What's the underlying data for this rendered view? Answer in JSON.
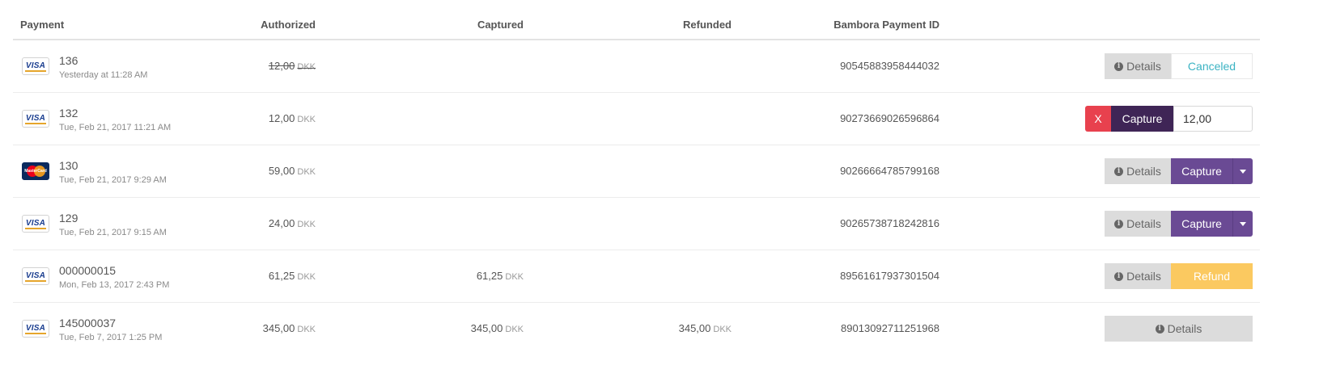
{
  "header": {
    "payment": "Payment",
    "authorized": "Authorized",
    "captured": "Captured",
    "refunded": "Refunded",
    "payment_id": "Bambora Payment ID"
  },
  "currency": "DKK",
  "actions": {
    "details": "Details",
    "canceled": "Canceled",
    "capture": "Capture",
    "cancel_x": "X",
    "refund": "Refund"
  },
  "rows": [
    {
      "card": "VISA",
      "order": "136",
      "date": "Yesterday at 11:28 AM",
      "authorized": "12,00",
      "captured": "",
      "refunded": "",
      "payment_id": "90545883958444032",
      "status": "canceled"
    },
    {
      "card": "VISA",
      "order": "132",
      "date": "Tue, Feb 21, 2017 11:21 AM",
      "authorized": "12,00",
      "captured": "",
      "refunded": "",
      "payment_id": "90273669026596864",
      "status": "capture-input",
      "capture_value": "12,00"
    },
    {
      "card": "MasterCard",
      "order": "130",
      "date": "Tue, Feb 21, 2017 9:29 AM",
      "authorized": "59,00",
      "captured": "",
      "refunded": "",
      "payment_id": "90266664785799168",
      "status": "capture"
    },
    {
      "card": "VISA",
      "order": "129",
      "date": "Tue, Feb 21, 2017 9:15 AM",
      "authorized": "24,00",
      "captured": "",
      "refunded": "",
      "payment_id": "90265738718242816",
      "status": "capture"
    },
    {
      "card": "VISA",
      "order": "000000015",
      "date": "Mon, Feb 13, 2017 2:43 PM",
      "authorized": "61,25",
      "captured": "61,25",
      "refunded": "",
      "payment_id": "89561617937301504",
      "status": "refund"
    },
    {
      "card": "VISA",
      "order": "145000037",
      "date": "Tue, Feb 7, 2017 1:25 PM",
      "authorized": "345,00",
      "captured": "345,00",
      "refunded": "345,00",
      "payment_id": "89013092711251968",
      "status": "details-only"
    }
  ]
}
